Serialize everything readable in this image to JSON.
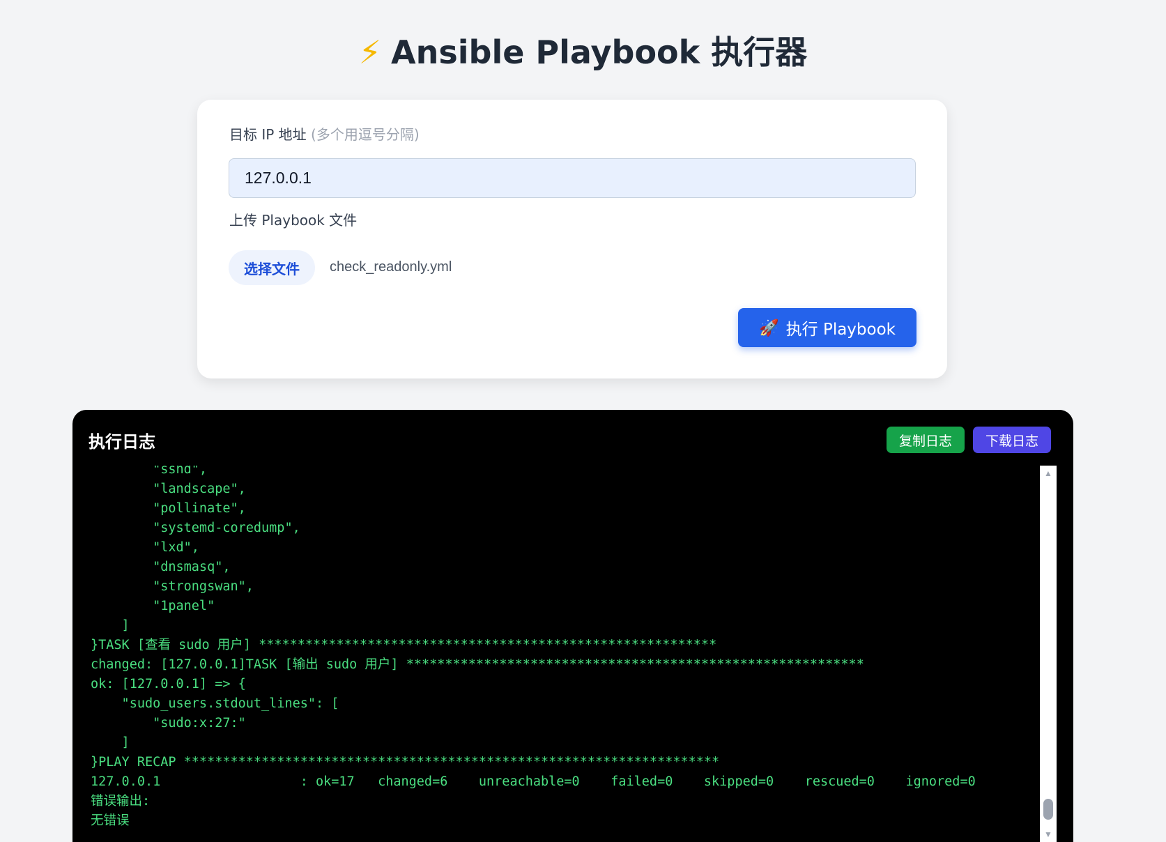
{
  "header": {
    "icon": "lightning-icon",
    "icon_glyph": "⚡",
    "title": "Ansible Playbook 执行器"
  },
  "form": {
    "ip_label": "目标 IP 地址",
    "ip_hint": "(多个用逗号分隔)",
    "ip_value": "127.0.0.1",
    "upload_label": "上传 Playbook 文件",
    "choose_file_label": "选择文件",
    "file_name": "check_readonly.yml",
    "run_icon": "rocket-icon",
    "run_icon_glyph": "🚀",
    "run_label": "执行 Playbook"
  },
  "log": {
    "title": "执行日志",
    "copy_label": "复制日志",
    "download_label": "下载日志",
    "scroll_up_glyph": "▲",
    "scroll_down_glyph": "▼",
    "lines": [
      "        \"sshd\",",
      "        \"landscape\",",
      "        \"pollinate\",",
      "        \"systemd-coredump\",",
      "        \"lxd\",",
      "        \"dnsmasq\",",
      "        \"strongswan\",",
      "        \"1panel\"",
      "    ]",
      "}TASK [查看 sudo 用户] ***********************************************************",
      "changed: [127.0.0.1]TASK [输出 sudo 用户] ***********************************************************",
      "ok: [127.0.0.1] => {",
      "    \"sudo_users.stdout_lines\": [",
      "        \"sudo:x:27:\"",
      "    ]",
      "}PLAY RECAP *********************************************************************",
      "127.0.0.1                  : ok=17   changed=6    unreachable=0    failed=0    skipped=0    rescued=0    ignored=0",
      "错误输出:",
      "无错误"
    ]
  }
}
